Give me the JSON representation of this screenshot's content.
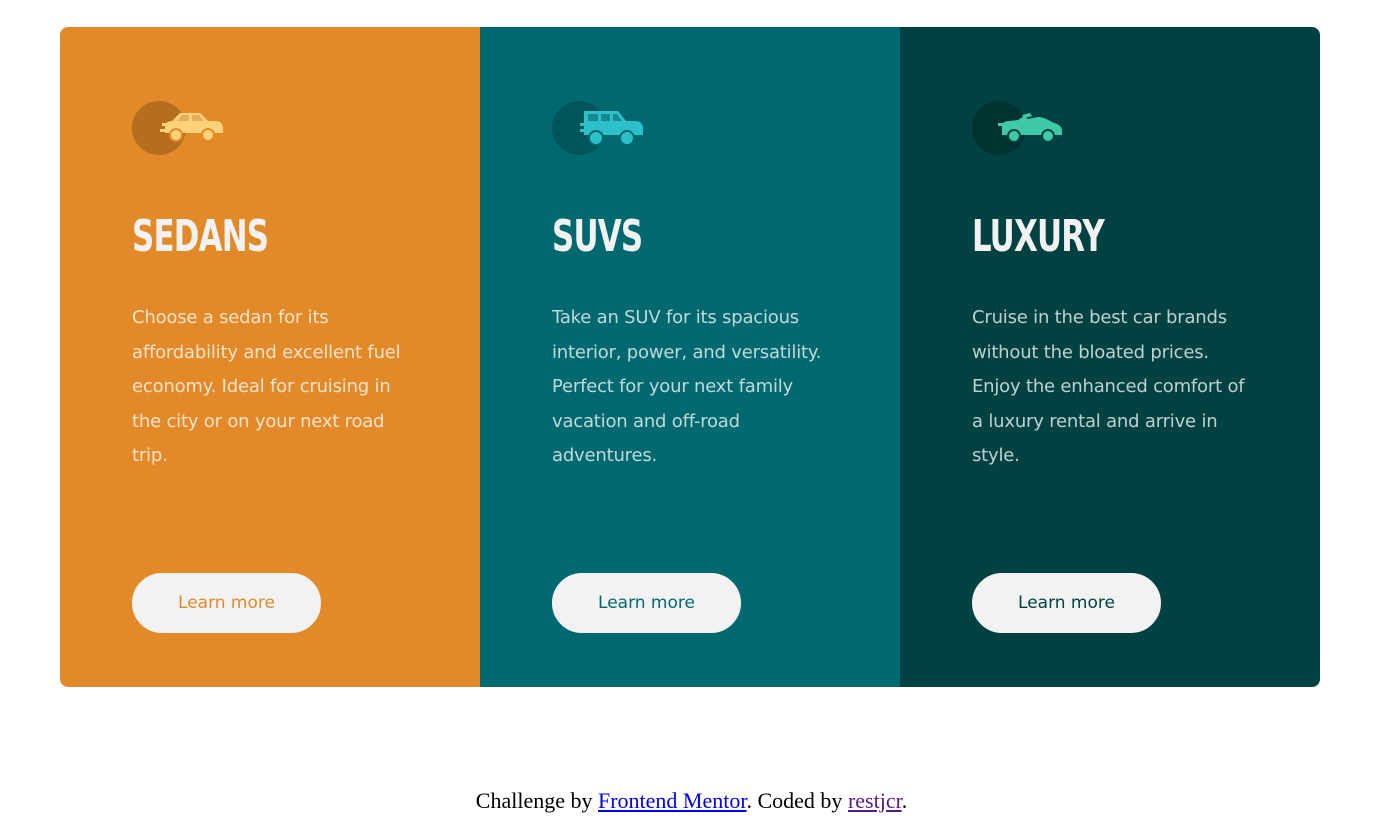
{
  "cards": [
    {
      "title": "Sedans",
      "text": "Choose a sedan for its affordability and excellent fuel economy. Ideal for cruising in the city or on your next road trip.",
      "button_label": "Learn more",
      "icon": "sedan-icon",
      "bg_color": "#e28a29",
      "icon_color": "#ffd27a",
      "icon_circle_color": "#b56d1f",
      "button_text_color": "#e28a29"
    },
    {
      "title": "SUVs",
      "text": "Take an SUV for its spacious interior, power, and versatility. Perfect for your next family vacation and off-road adventures.",
      "button_label": "Learn more",
      "icon": "suv-icon",
      "bg_color": "#006970",
      "icon_color": "#2ec0c9",
      "icon_circle_color": "#00545a",
      "button_text_color": "#006970"
    },
    {
      "title": "Luxury",
      "text": "Cruise in the best car brands without the bloated prices. Enjoy the enhanced comfort of a luxury rental and arrive in style.",
      "button_label": "Learn more",
      "icon": "luxury-car-icon",
      "bg_color": "#004241",
      "icon_color": "#3ec9a7",
      "icon_circle_color": "#003232",
      "button_text_color": "#004241"
    }
  ],
  "footer": {
    "prefix": "Challenge by ",
    "link1": "Frontend Mentor",
    "middle": ". Coded by ",
    "link2": "restjcr",
    "suffix": "."
  }
}
